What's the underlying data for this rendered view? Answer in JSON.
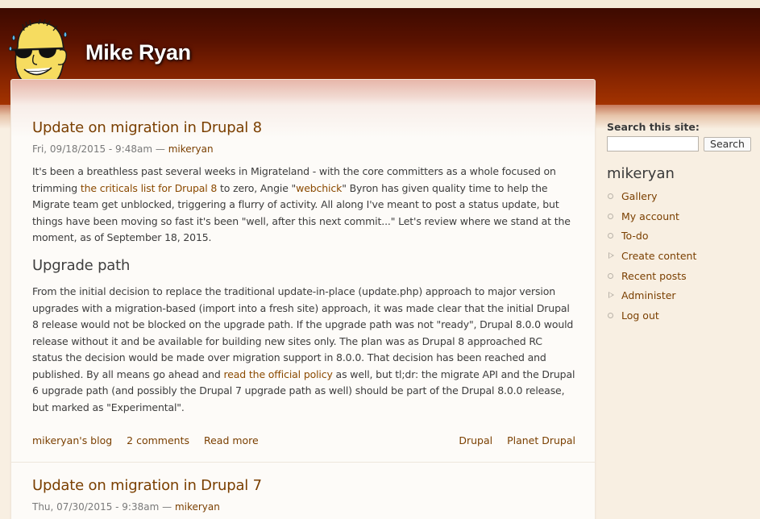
{
  "site": {
    "name": "Mike Ryan",
    "logo_icon": "cartoon-avatar-with-sunglasses"
  },
  "posts": [
    {
      "title": "Update on migration in Drupal 8",
      "date": "Fri, 09/18/2015 - 9:48am",
      "meta_separator": " — ",
      "author": "mikeryan",
      "intro": {
        "t1": "It's been a breathless past several weeks in Migrateland - with the core committers as a whole focused on trimming ",
        "link1": "the criticals list for Drupal 8",
        "t2": " to zero, Angie \"",
        "link2": "webchick",
        "t3": "\" Byron has given quality time to help the Migrate team get unblocked, triggering a flurry of activity. All along I've meant to post a status update, but things have been moving so fast it's been \"well, after this next commit...\" Let's review where we stand at the moment, as of September 18, 2015."
      },
      "section_heading": "Upgrade path",
      "body": {
        "t1": "From the initial decision to replace the traditional update-in-place (update.php) approach to major version upgrades with a migration-based (import into a fresh site) approach, it was made clear that the initial Drupal 8 release would not be blocked on the upgrade path. If the upgrade path was not \"ready\", Drupal 8.0.0 would release without it and be available for building new sites only. The plan was as Drupal 8 approached RC status the decision would be made over migration support in 8.0.0. That decision has been reached and published. By all means go ahead and ",
        "link1": "read the official policy",
        "t2": " as well, but tl;dr: the migrate API and the Drupal 6 upgrade path (and possibly the Drupal 7 upgrade path as well) should be part of the Drupal 8.0.0 release, but marked as \"Experimental\"."
      },
      "links_left": [
        "mikeryan's blog",
        "2 comments",
        "Read more"
      ],
      "links_right": [
        "Drupal",
        "Planet Drupal"
      ]
    },
    {
      "title": "Update on migration in Drupal 7",
      "date": "Thu, 07/30/2015 - 9:38am",
      "meta_separator": " — ",
      "author": "mikeryan"
    }
  ],
  "sidebar": {
    "search_label": "Search this site:",
    "search_value": "",
    "search_button": "Search",
    "user_block_title": "mikeryan",
    "menu": [
      {
        "label": "Gallery",
        "marker": "bullet"
      },
      {
        "label": "My account",
        "marker": "bullet"
      },
      {
        "label": "To-do",
        "marker": "bullet"
      },
      {
        "label": "Create content",
        "marker": "arrow"
      },
      {
        "label": "Recent posts",
        "marker": "bullet"
      },
      {
        "label": "Administer",
        "marker": "arrow"
      },
      {
        "label": "Log out",
        "marker": "bullet"
      }
    ]
  },
  "colors": {
    "header_dark": "#3d0a00",
    "header_light": "#a33300",
    "link": "#7a3f00",
    "page_bg": "#f8efe2"
  }
}
